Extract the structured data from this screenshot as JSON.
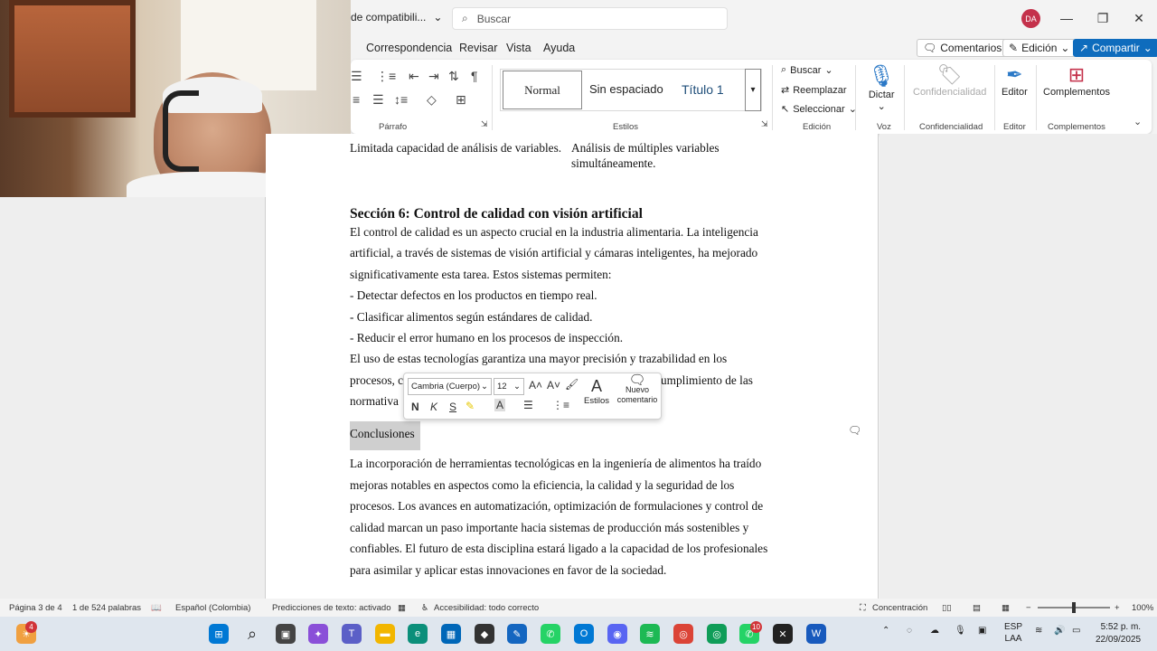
{
  "titlebar": {
    "doc_title": "de compatibili...",
    "search_placeholder": "Buscar",
    "avatar_initials": "DA",
    "minimize": "—",
    "restore": "❐",
    "close": "✕"
  },
  "menu": {
    "items": [
      "Correspondencia",
      "Revisar",
      "Vista",
      "Ayuda"
    ],
    "comments_label": "Comentarios",
    "edit_mode_label": "Edición",
    "share_label": "Compartir"
  },
  "ribbon": {
    "paragraph_label": "Párrafo",
    "styles_label": "Estilos",
    "styles": [
      "Normal",
      "Sin espaciado",
      "Título 1"
    ],
    "edicion_label": "Edición",
    "buscar": "Buscar",
    "reemplazar": "Reemplazar",
    "seleccionar": "Seleccionar",
    "dictar": "Dictar",
    "voz_label": "Voz",
    "confidencialidad": "Confidencialidad",
    "confidencialidad_label": "Confidencialidad",
    "editor": "Editor",
    "editor_label": "Editor",
    "complementos": "Complementos",
    "complementos_label": "Complementos"
  },
  "document": {
    "table_left": "Limitada capacidad de análisis de variables.",
    "table_right_1": "Análisis de múltiples variables",
    "table_right_2": "simultáneamente.",
    "section_heading": "Sección 6: Control de calidad con visión artificial",
    "lines": [
      "El control de calidad es un aspecto crucial en la industria alimentaria. La inteligencia",
      "artificial, a través de sistemas de visión artificial y cámaras inteligentes, ha mejorado",
      "significativamente esta tarea. Estos sistemas permiten:",
      "- Detectar defectos en los productos en tiempo real.",
      "- Clasificar alimentos según estándares de calidad.",
      "- Reducir el error humano en los procesos de inspección.",
      "El uso de estas tecnologías garantiza una mayor precisión y trazabilidad en los"
    ],
    "partial_left_1": "procesos, c",
    "partial_right_1": "umplimiento de las",
    "partial_left_2": "normativa",
    "conclusions_heading": "Conclusiones",
    "conclusion_lines": [
      "La incorporación de herramientas tecnológicas en la ingeniería de alimentos ha traído",
      "mejoras notables en aspectos como la eficiencia, la calidad y la seguridad de los",
      "procesos. Los avances en automatización, optimización de formulaciones y control de",
      "calidad marcan un paso importante hacia sistemas de producción más sostenibles y",
      "confiables. El futuro de esta disciplina estará ligado a la capacidad de los profesionales",
      "para asimilar y aplicar estas innovaciones en favor de la sociedad."
    ]
  },
  "mini_toolbar": {
    "font": "Cambria (Cuerpo)",
    "size": "12",
    "bold": "N",
    "italic": "K",
    "underline": "S",
    "estilos": "Estilos",
    "nuevo": "Nuevo",
    "comentario": "comentario"
  },
  "status": {
    "page": "Página 3 de 4",
    "words": "1 de 524 palabras",
    "language": "Español (Colombia)",
    "predictions": "Predicciones de texto: activado",
    "accessibility": "Accesibilidad: todo correcto",
    "focus": "Concentración",
    "zoom": "100%"
  },
  "taskbar": {
    "weather_badge": "4",
    "whatsapp_badge": "10",
    "lang_1": "ESP",
    "lang_2": "LAA",
    "time": "5:52 p. m.",
    "date": "22/09/2025"
  }
}
